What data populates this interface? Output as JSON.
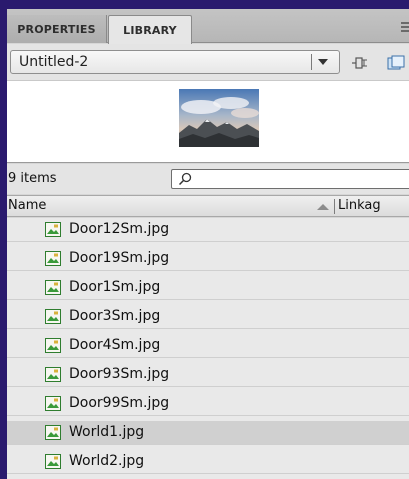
{
  "tabs": [
    {
      "label": "PROPERTIES",
      "active": false
    },
    {
      "label": "LIBRARY",
      "active": true
    }
  ],
  "document_select": {
    "value": "Untitled-2"
  },
  "count_text": "9 items",
  "search": {
    "placeholder": ""
  },
  "columns": {
    "name": "Name",
    "linkage": "Linkag"
  },
  "items": [
    {
      "label": "Door12Sm.jpg",
      "icon": "bitmap-icon",
      "selected": false
    },
    {
      "label": "Door19Sm.jpg",
      "icon": "bitmap-icon",
      "selected": false
    },
    {
      "label": "Door1Sm.jpg",
      "icon": "bitmap-icon",
      "selected": false
    },
    {
      "label": "Door3Sm.jpg",
      "icon": "bitmap-icon",
      "selected": false
    },
    {
      "label": "Door4Sm.jpg",
      "icon": "bitmap-icon",
      "selected": false
    },
    {
      "label": "Door93Sm.jpg",
      "icon": "bitmap-icon",
      "selected": false
    },
    {
      "label": "Door99Sm.jpg",
      "icon": "bitmap-icon",
      "selected": false
    },
    {
      "label": "World1.jpg",
      "icon": "bitmap-icon",
      "selected": true
    },
    {
      "label": "World2.jpg",
      "icon": "bitmap-icon",
      "selected": false
    }
  ],
  "colors": {
    "border": "#2a1a6e",
    "selected_row": "#d0d0d0",
    "row": "#e9e9e9"
  }
}
